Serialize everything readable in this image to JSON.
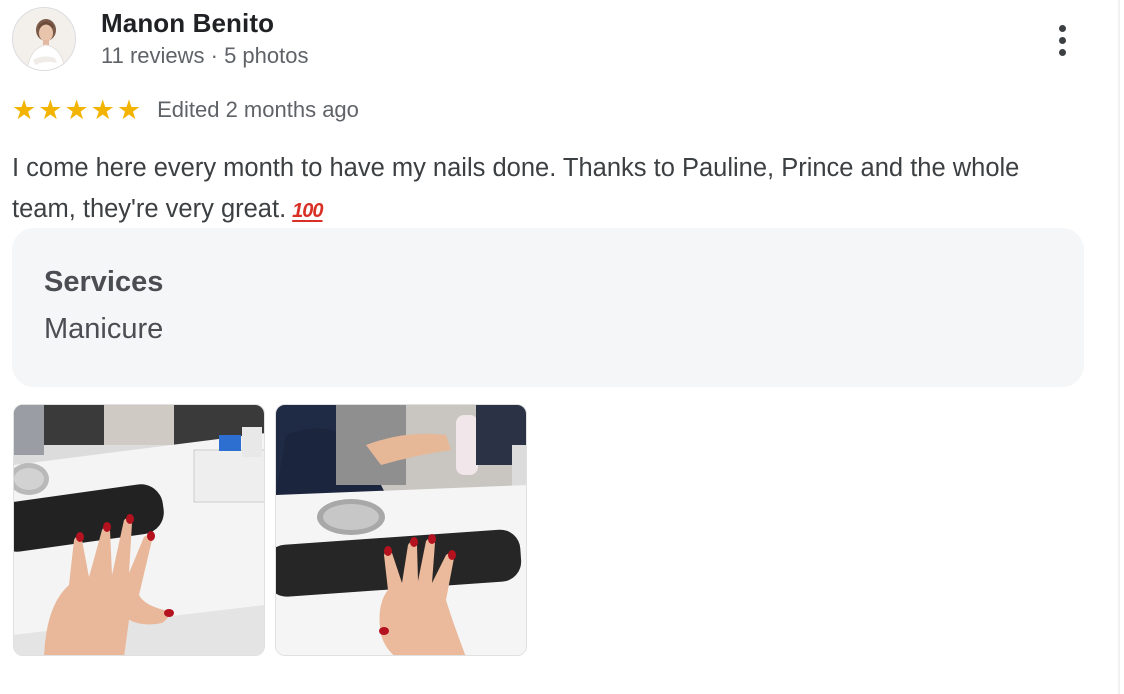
{
  "reviewer": {
    "name": "Manon Benito",
    "meta": "11 reviews · 5 photos"
  },
  "rating": {
    "stars": 5,
    "edited": "Edited 2 months ago",
    "star_color": "#f2b400"
  },
  "review": {
    "text": "I come here every month to have my nails done. Thanks to Pauline, Prince and the whole team, they're very great.",
    "emoji": "100"
  },
  "services": {
    "heading": "Services",
    "value": "Manicure"
  },
  "photos": [
    {
      "icon": "manicure-photo"
    },
    {
      "icon": "manicure-photo"
    }
  ],
  "menu": {
    "icon": "more-vert-icon"
  }
}
